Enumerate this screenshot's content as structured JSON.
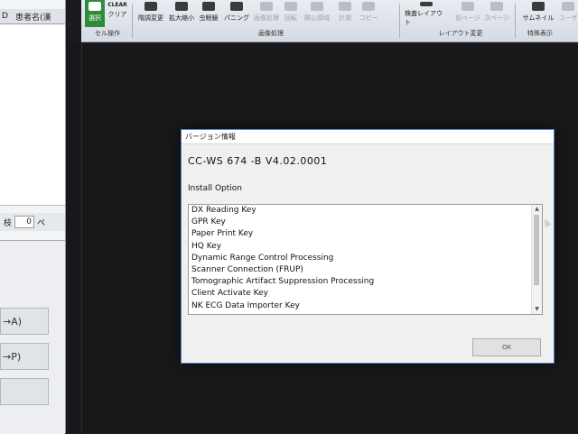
{
  "ribbon": {
    "buttons": [
      {
        "label": "選択",
        "icon": "arrow-select-icon",
        "state": "selected"
      },
      {
        "label": "クリア",
        "icon": "clear-icon",
        "state": "normal",
        "sublabel": "CLEAR"
      },
      {
        "label": "階調変更",
        "icon": "contrast-icon",
        "state": "normal"
      },
      {
        "label": "拡大縮小",
        "icon": "zoom-icon",
        "state": "normal"
      },
      {
        "label": "虫眼鏡",
        "icon": "magnifier-icon",
        "state": "normal"
      },
      {
        "label": "パニング",
        "icon": "hand-pan-icon",
        "state": "normal"
      },
      {
        "label": "画像処理",
        "icon": "image-process-icon",
        "state": "disabled"
      },
      {
        "label": "回転",
        "icon": "rotate-icon",
        "state": "disabled"
      },
      {
        "label": "関心領域",
        "icon": "roi-icon",
        "state": "disabled"
      },
      {
        "label": "計測",
        "icon": "measure-icon",
        "state": "disabled"
      },
      {
        "label": "コピー",
        "icon": "copy-icon",
        "state": "disabled"
      },
      {
        "label": "検査レイアウト",
        "icon": "layout-icon",
        "state": "normal"
      },
      {
        "label": "前ページ",
        "icon": "prev-page-icon",
        "state": "disabled"
      },
      {
        "label": "次ページ",
        "icon": "next-page-icon",
        "state": "disabled"
      },
      {
        "label": "サムネイル",
        "icon": "thumbnail-icon",
        "state": "normal"
      },
      {
        "label": "ユーザ",
        "icon": "user-icon",
        "state": "disabled"
      }
    ],
    "groups": [
      "セル操作",
      "画像処理",
      "レイアウト変更",
      "特殊表示"
    ]
  },
  "left_panel": {
    "header_cols": [
      "D",
      "患者名(漢"
    ],
    "count_label": "枝",
    "count_value": "0",
    "count_suffix": "ペ",
    "items": [
      "→A)",
      "→P)",
      ""
    ]
  },
  "dialog": {
    "title": "バージョン情報",
    "version": "CC-WS 674  -B V4.02.0001",
    "install_option_label": "Install Option",
    "options": [
      "DX Reading Key",
      "GPR Key",
      "Paper Print Key",
      "HQ Key",
      "Dynamic Range Control Processing",
      "Scanner Connection (FRUP)",
      "Tomographic Artifact Suppression Processing",
      "Client Activate Key",
      "NK ECG Data Importer Key"
    ],
    "ok_label": "OK",
    "scroll_up": "▲",
    "scroll_down": "▼"
  },
  "colors": {
    "dialog_border": "#4a87c9",
    "selected_tool": "#2f8c3a",
    "workspace_bg": "#18181b"
  }
}
